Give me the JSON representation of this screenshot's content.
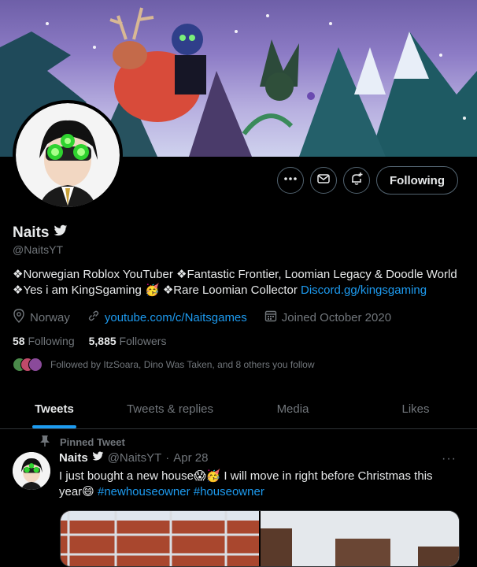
{
  "profile": {
    "name": "Naits",
    "handle": "@NaitsYT",
    "bio_line1": "❖Norwegian Roblox YouTuber ❖Fantastic Frontier, Loomian Legacy & Doodle World",
    "bio_line2_text": "❖Yes i am KingSgaming 🥳 ❖Rare Loomian Collector ",
    "bio_link": "Discord.gg/kingsgaming",
    "location": "Norway",
    "website": "youtube.com/c/Naitsgames",
    "joined": "Joined October 2020",
    "following_count": "58",
    "following_label": "Following",
    "followers_count": "5,885",
    "followers_label": "Followers",
    "followed_by": "Followed by ItzSoara, Dino Was Taken, and 8 others you follow"
  },
  "actions": {
    "more_icon": "more-horizontal-icon",
    "message_icon": "envelope-icon",
    "notify_icon": "bell-plus-icon",
    "follow_label": "Following"
  },
  "tabs": [
    {
      "label": "Tweets"
    },
    {
      "label": "Tweets & replies"
    },
    {
      "label": "Media"
    },
    {
      "label": "Likes"
    }
  ],
  "pinned_tweet": {
    "pinned_label": "Pinned Tweet",
    "name": "Naits",
    "handle": "@NaitsYT",
    "dot": "·",
    "date": "Apr 28",
    "text": "I just bought a new house😱🥳 I will move in right before Christmas this year😄 ",
    "hashtag1": "#newhouseowner",
    "hashtag2": "#houseowner",
    "more": "···"
  },
  "colors": {
    "accent": "#1d9bf0",
    "background": "#000000",
    "text_primary": "#e7e9ea",
    "text_secondary": "#71767b"
  }
}
